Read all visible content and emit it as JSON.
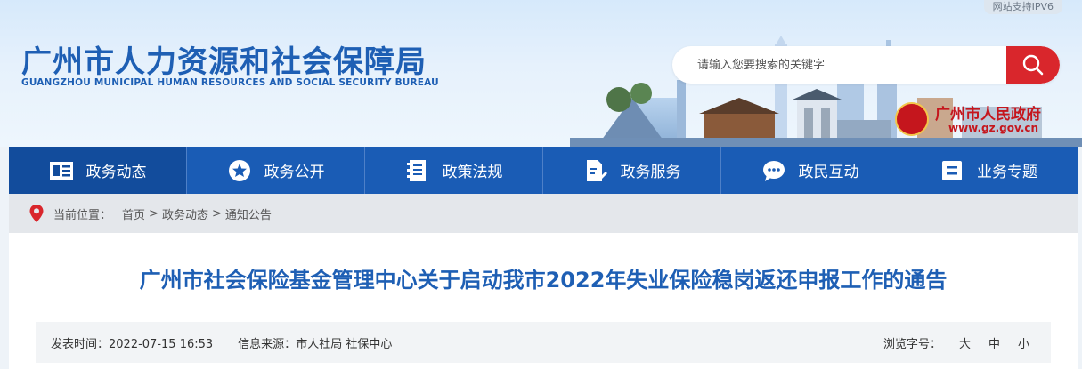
{
  "header": {
    "ipv6_badge": "网站支持IPV6",
    "title_cn": "广州市人力资源和社会保障局",
    "title_en": "GUANGZHOU MUNICIPAL HUMAN RESOURCES AND SOCIAL SECURITY BUREAU",
    "search": {
      "placeholder": "请输入您要搜索的关键字",
      "value": ""
    },
    "gov_link": {
      "name": "广州市人民政府",
      "url": "www.gz.gov.cn"
    }
  },
  "nav": {
    "items": [
      {
        "label": "政务动态",
        "icon": "news-icon",
        "active": true
      },
      {
        "label": "政务公开",
        "icon": "star-icon"
      },
      {
        "label": "政策法规",
        "icon": "document-icon"
      },
      {
        "label": "政务服务",
        "icon": "file-edit-icon"
      },
      {
        "label": "政民互动",
        "icon": "chat-icon"
      },
      {
        "label": "业务专题",
        "icon": "list-icon"
      }
    ]
  },
  "breadcrumb": {
    "prefix": "当前位置：",
    "items": [
      "首页",
      "政务动态",
      "通知公告"
    ],
    "separator": ">"
  },
  "article": {
    "title": "广州市社会保险基金管理中心关于启动我市2022年失业保险稳岗返还申报工作的通告",
    "publish_label": "发表时间：",
    "publish_time": "2022-07-15 16:53",
    "source_label": "信息来源：",
    "source": "市人社局 社保中心",
    "font_size_label": "浏览字号：",
    "font_sizes": [
      "大",
      "中",
      "小"
    ]
  },
  "colors": {
    "brand_blue": "#1a5cb5",
    "title_blue": "#1e5fb4",
    "search_red": "#d9262c",
    "gov_red": "#c5161d"
  }
}
